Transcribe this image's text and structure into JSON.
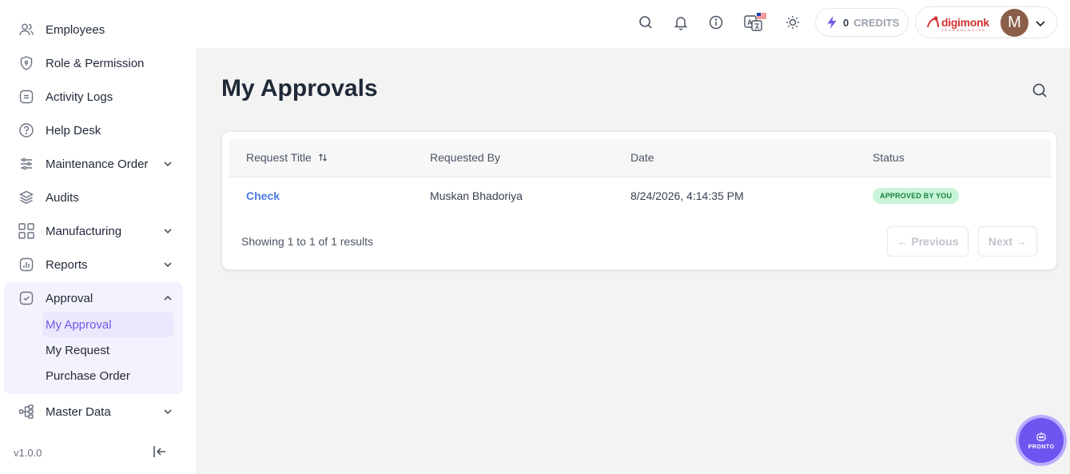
{
  "sidebar": {
    "items": [
      {
        "label": "Employees"
      },
      {
        "label": "Role & Permission"
      },
      {
        "label": "Activity Logs"
      },
      {
        "label": "Help Desk"
      },
      {
        "label": "Maintenance Order"
      },
      {
        "label": "Audits"
      },
      {
        "label": "Manufacturing"
      },
      {
        "label": "Reports"
      },
      {
        "label": "Approval"
      },
      {
        "label": "Master Data"
      }
    ],
    "approval_sub": [
      {
        "label": "My Approval"
      },
      {
        "label": "My Request"
      },
      {
        "label": "Purchase Order"
      }
    ],
    "version": "v1.0.0"
  },
  "topbar": {
    "credits_value": "0",
    "credits_label": "CREDITS",
    "brand": "digimonk",
    "brand_sub": "TECHNOLOGIES",
    "avatar_initial": "M"
  },
  "page": {
    "title": "My Approvals"
  },
  "table": {
    "columns": [
      "Request Title",
      "Requested By",
      "Date",
      "Status"
    ],
    "rows": [
      {
        "title": "Check",
        "requested_by": "Muskan Bhadoriya",
        "date": "8/24/2026, 4:14:35 PM",
        "status": "APPROVED BY YOU"
      }
    ],
    "showing": "Showing 1 to 1 of 1 results",
    "prev": "← Previous",
    "next": "Next →"
  },
  "assistant": {
    "label": "PRONTO"
  },
  "colors": {
    "accent": "#6d5ce7",
    "link": "#4a7be0",
    "status_bg": "#c8f5d8",
    "status_text": "#15803d"
  }
}
